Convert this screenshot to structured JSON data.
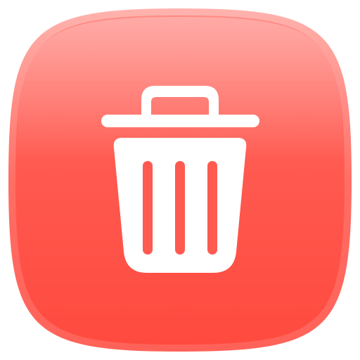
{
  "app_icon": {
    "name": "trash-app-icon",
    "glyph": "trash-icon",
    "colors": {
      "tile_top": "#FF8A84",
      "tile_mid": "#FF5A50",
      "tile_bottom": "#FF4A3F",
      "rim": "#FF6A60",
      "glyph": "#FFFFFF"
    }
  }
}
